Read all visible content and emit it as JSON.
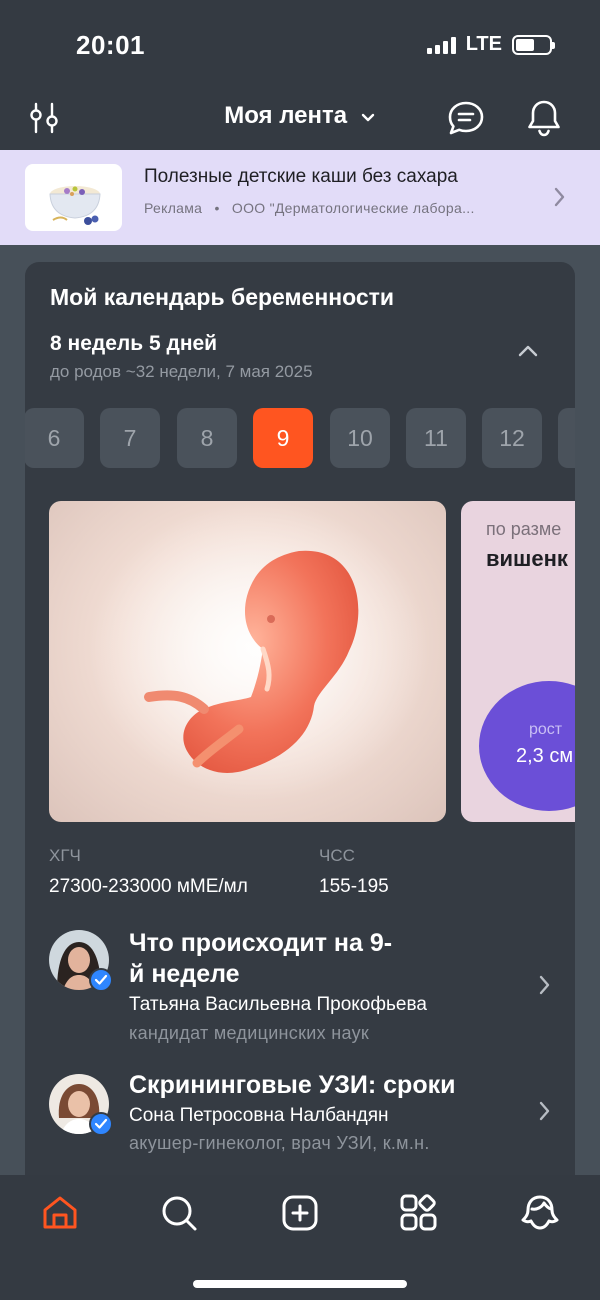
{
  "status_bar": {
    "time": "20:01",
    "network": "LTE"
  },
  "header": {
    "title": "Моя лента"
  },
  "ad": {
    "title": "Полезные детские каши без сахара",
    "label": "Реклама",
    "separator": "•",
    "advertiser": "ООО \"Дерматологические лабора..."
  },
  "pregnancy": {
    "title": "Мой календарь беременности",
    "weeks_days": "8 недель 5 дней",
    "due": "до родов ~32 недели, 7 мая 2025",
    "weeks": [
      "6",
      "7",
      "8",
      "9",
      "10",
      "11",
      "12"
    ],
    "selected_week": "9",
    "size_label": "по разме",
    "size_value": "вишенк",
    "growth_label": "рост",
    "growth_value": "2,3 см",
    "stats": [
      {
        "label": "ХГЧ",
        "value": "27300-233000 мМЕ/мл"
      },
      {
        "label": "ЧСС",
        "value": "155-195"
      }
    ]
  },
  "articles": [
    {
      "title_line1": "Что происходит на 9-",
      "title_line2": "й неделе",
      "author": "Татьяна Васильевна Прокофьева",
      "role": "кандидат медицинских наук"
    },
    {
      "title_line1": "Скрининговые УЗИ: сроки",
      "author": "Сона Петросовна Налбандян",
      "role": "акушер-гинеколог, врач УЗИ, к.м.н."
    }
  ],
  "colors": {
    "accent": "#ff5520",
    "ad_background": "#e2dcf8",
    "verified": "#2f86ff",
    "growth_circle": "#6b4fd7"
  },
  "icons": {
    "filter": "filter-sliders-icon",
    "chat": "chat-icon",
    "bell": "bell-icon",
    "home": "home-icon",
    "search": "search-icon",
    "add": "add-icon",
    "services": "services-grid-icon",
    "profile": "profile-icon"
  }
}
